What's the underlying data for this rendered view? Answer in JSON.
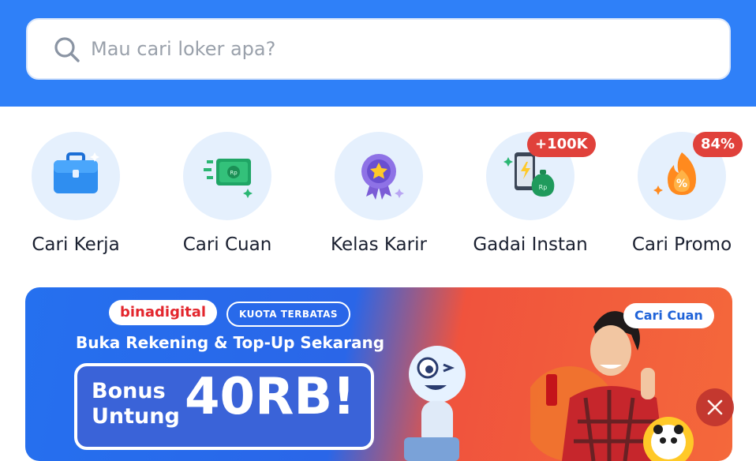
{
  "search": {
    "placeholder": "Mau cari loker apa?",
    "icon": "search-icon"
  },
  "menu": [
    {
      "label": "Cari Kerja",
      "icon": "briefcase-icon"
    },
    {
      "label": "Cari Cuan",
      "icon": "money-icon"
    },
    {
      "label": "Kelas Karir",
      "icon": "badge-star-icon"
    },
    {
      "label": "Gadai Instan",
      "icon": "phone-moneybag-icon",
      "badge": "+100K"
    },
    {
      "label": "Cari Promo",
      "icon": "fire-percent-icon",
      "badge": "84%"
    }
  ],
  "banner": {
    "brand": "binadigital",
    "tag": "KUOTA TERBATAS",
    "headline": "Buka Rekening & Top-Up Sekarang",
    "bonus_small_1": "Bonus",
    "bonus_small_2": "Untung",
    "bonus_big": "40RB!",
    "chip": "Cari Cuan"
  },
  "colors": {
    "header": "#2f80f8",
    "badge": "#e0413b",
    "icon_bg": "#e5f0fd"
  }
}
